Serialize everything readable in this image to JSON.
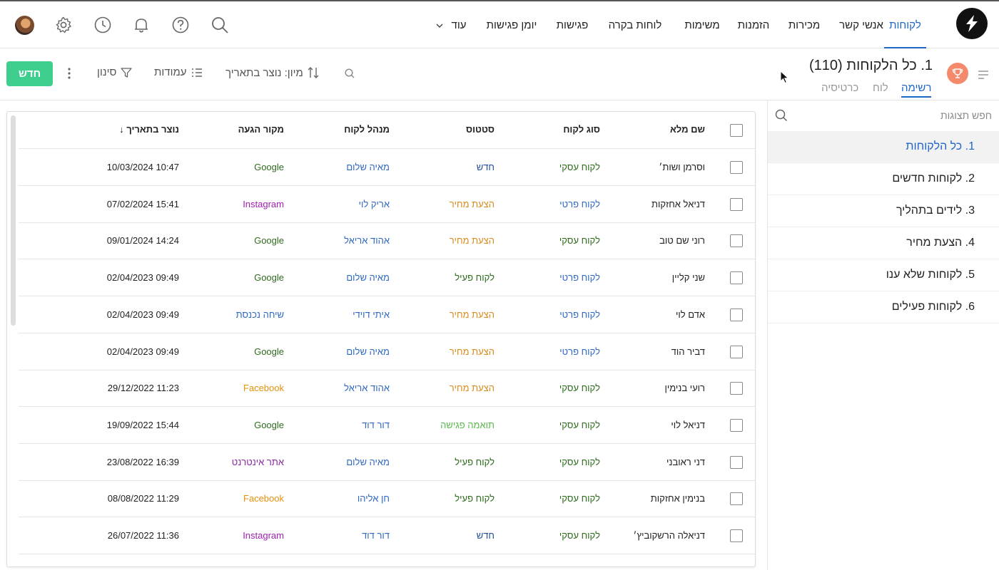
{
  "nav": {
    "tabs": [
      "לקוחות",
      "אנשי קשר",
      "מכירות",
      "הזמנות",
      "משימות",
      "לוחות בקרה",
      "פגישות",
      "יומן פגישות",
      "עוד"
    ],
    "active_tab": "לקוחות"
  },
  "colors": {
    "accent": "#1e66c7",
    "primary_button": "#3ecf8e",
    "trophy": "#f4896b"
  },
  "icons": [
    "logo-icon",
    "search-icon",
    "help-icon",
    "bell-icon",
    "clock-icon",
    "gear-icon",
    "avatar"
  ],
  "view": {
    "title": "1. כל הלקוחות",
    "count": "(110)",
    "tabs": [
      "רשימה",
      "לוח",
      "כרטיסיה"
    ],
    "active_tab": "רשימה"
  },
  "toolbar": {
    "sort_label": "מיון: נוצר בתאריך",
    "columns_label": "עמודות",
    "filter_label": "סינון",
    "new_label": "חדש"
  },
  "sidebar": {
    "search_placeholder": "חפש תצוגות",
    "views": [
      "1. כל הלקוחות",
      "2. לקוחות חדשים",
      "3. לידים בתהליך",
      "4. הצעת מחיר",
      "5. לקוחות שלא ענו",
      "6. לקוחות פעילים"
    ],
    "active_index": 0
  },
  "table": {
    "headers": {
      "name": "שם מלא",
      "type": "סוג לקוח",
      "status": "סטטוס",
      "manager": "מנהל לקוח",
      "source": "מקור הגעה",
      "created": "נוצר בתאריך ↓"
    },
    "rows": [
      {
        "name": "וסרמן ושות׳",
        "type": "לקוח עסקי",
        "status": "חדש",
        "manager": "מאיה שלום",
        "source": "Google",
        "created": "10/03/2024 10:47"
      },
      {
        "name": "דניאל אחזקות",
        "type": "לקוח פרטי",
        "status": "הצעת מחיר",
        "manager": "אריק לוי",
        "source": "Instagram",
        "created": "07/02/2024 15:41"
      },
      {
        "name": "רוני שם טוב",
        "type": "לקוח עסקי",
        "status": "הצעת מחיר",
        "manager": "אהוד אריאל",
        "source": "Google",
        "created": "09/01/2024 14:24"
      },
      {
        "name": "שני קליין",
        "type": "לקוח פרטי",
        "status": "לקוח פעיל",
        "manager": "מאיה שלום",
        "source": "Google",
        "created": "02/04/2023 09:49"
      },
      {
        "name": "אדם לוי",
        "type": "לקוח פרטי",
        "status": "הצעת מחיר",
        "manager": "איתי דוידי",
        "source": "שיחה נכנסת",
        "created": "02/04/2023 09:49"
      },
      {
        "name": "דביר הוד",
        "type": "לקוח פרטי",
        "status": "הצעת מחיר",
        "manager": "מאיה שלום",
        "source": "Google",
        "created": "02/04/2023 09:49"
      },
      {
        "name": "רועי בנימין",
        "type": "לקוח עסקי",
        "status": "הצעת מחיר",
        "manager": "אהוד אריאל",
        "source": "Facebook",
        "created": "29/12/2022 11:23"
      },
      {
        "name": "דניאל לוי",
        "type": "לקוח עסקי",
        "status": "תואמה פגישה",
        "manager": "דור דוד",
        "source": "Google",
        "created": "19/09/2022 15:44"
      },
      {
        "name": "דני ראובני",
        "type": "לקוח עסקי",
        "status": "לקוח פעיל",
        "manager": "מאיה שלום",
        "source": "אתר אינטרנט",
        "created": "23/08/2022 16:39"
      },
      {
        "name": "בנימין אחזקות",
        "type": "לקוח עסקי",
        "status": "לקוח פעיל",
        "manager": "חן אליהו",
        "source": "Facebook",
        "created": "08/08/2022 11:29"
      },
      {
        "name": "דניאלה הרשקוביץ׳",
        "type": "לקוח עסקי",
        "status": "חדש",
        "manager": "דור דוד",
        "source": "Instagram",
        "created": "26/07/2022 11:36"
      }
    ],
    "value_colors": {
      "לקוח עסקי": "#2e6b1e",
      "לקוח פרטי": "#3069c2",
      "חדש": "#1f4e96",
      "הצעת מחיר": "#d98b1b",
      "לקוח פעיל": "#2e6b1e",
      "תואמה פגישה": "#58b84b",
      "Google": "#2e6b1e",
      "Instagram": "#a020b0",
      "Facebook": "#e3920e",
      "שיחה נכנסת": "#3069c2",
      "אתר אינטרנט": "#8a2ba0"
    }
  }
}
